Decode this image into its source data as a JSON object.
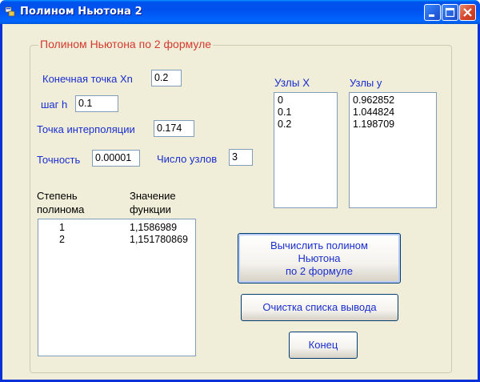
{
  "window": {
    "title": "Полином Ньютона 2"
  },
  "group": {
    "title": "Полином Ньютона по 2 формуле"
  },
  "fields": {
    "xn_label": "Конечная точка Xn",
    "xn_value": "0.2",
    "h_label": "шаг h",
    "h_value": "0.1",
    "interp_label": "Точка интерполяции",
    "interp_value": "0.174",
    "accuracy_label": "Точность",
    "accuracy_value": "0.00001",
    "nodes_count_label": "Число узлов",
    "nodes_count_value": "3"
  },
  "nodes": {
    "x_label": "Узлы X",
    "x_values": [
      "0",
      "0.1",
      "0.2"
    ],
    "y_label": "Узлы y",
    "y_values": [
      "0.962852",
      "1.044824",
      "1.198709"
    ]
  },
  "output": {
    "col1_header_1": "Степень",
    "col1_header_2": "полинома",
    "col2_header_1": "Значение",
    "col2_header_2": "функции",
    "rows": [
      {
        "degree": "1",
        "value": "1,1586989"
      },
      {
        "degree": "2",
        "value": "1,151780869"
      }
    ]
  },
  "buttons": {
    "compute": "Вычислить полином\nНьютона\nпо 2 формуле",
    "clear": "Очистка списка вывода",
    "exit": "Конец"
  },
  "colors": {
    "label": "#1a2ecf",
    "group_title": "#d53a2f",
    "titlebar": "#0053ee"
  }
}
